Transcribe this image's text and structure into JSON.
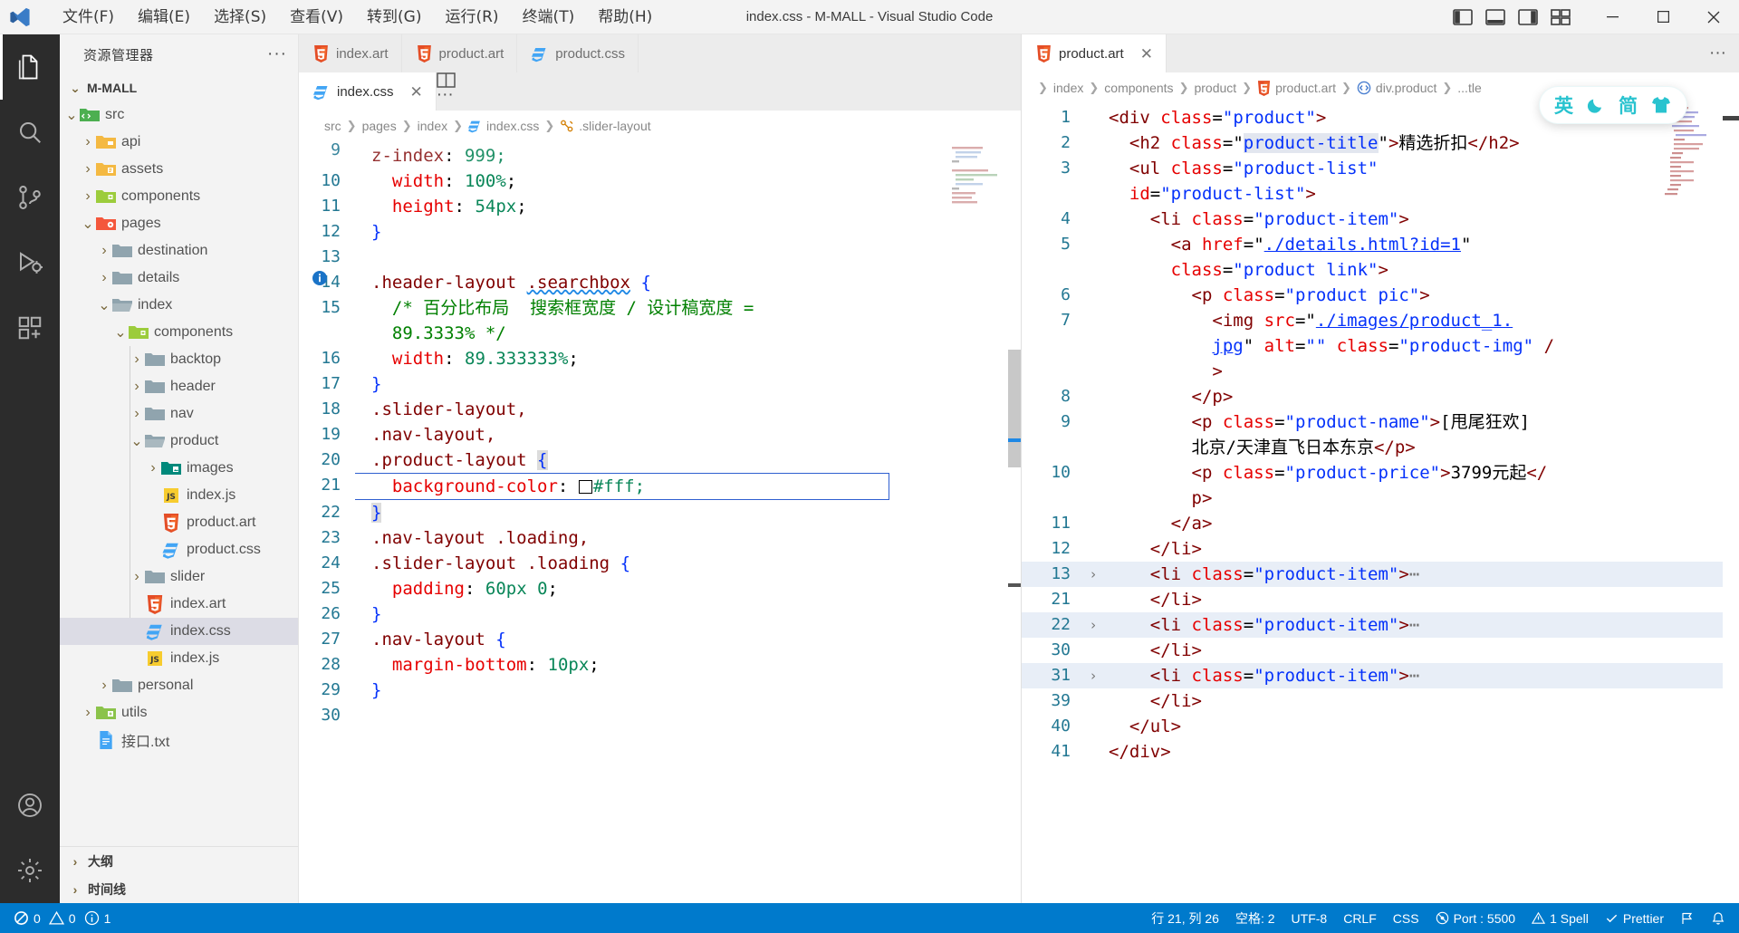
{
  "titlebar": {
    "menus": [
      "文件(F)",
      "编辑(E)",
      "选择(S)",
      "查看(V)",
      "转到(G)",
      "运行(R)",
      "终端(T)",
      "帮助(H)"
    ],
    "window_title": "index.css - M-MALL - Visual Studio Code",
    "minimize": "−",
    "maximize": "▭",
    "close": "✕"
  },
  "activitybar": {
    "items": [
      "explorer-icon",
      "search-icon",
      "source-control-icon",
      "run-debug-icon",
      "extensions-icon",
      "accounts-icon",
      "settings-icon"
    ]
  },
  "sidebar": {
    "title": "资源管理器",
    "more": "···",
    "project": "M-MALL",
    "tree": [
      {
        "label": "src",
        "depth": 1,
        "chev": "v",
        "icon": "folder-src",
        "sel": false
      },
      {
        "label": "api",
        "depth": 2,
        "chev": ">",
        "icon": "folder-api",
        "sel": false
      },
      {
        "label": "assets",
        "depth": 2,
        "chev": ">",
        "icon": "folder-assets",
        "sel": false
      },
      {
        "label": "components",
        "depth": 2,
        "chev": ">",
        "icon": "folder-components",
        "sel": false
      },
      {
        "label": "pages",
        "depth": 2,
        "chev": "v",
        "icon": "folder-pages",
        "sel": false
      },
      {
        "label": "destination",
        "depth": 3,
        "chev": ">",
        "icon": "folder-plain",
        "sel": false
      },
      {
        "label": "details",
        "depth": 3,
        "chev": ">",
        "icon": "folder-plain",
        "sel": false
      },
      {
        "label": "index",
        "depth": 3,
        "chev": "v",
        "icon": "folder-open",
        "sel": false
      },
      {
        "label": "components",
        "depth": 4,
        "chev": "v",
        "icon": "folder-components",
        "sel": false
      },
      {
        "label": "backtop",
        "depth": 5,
        "chev": ">",
        "icon": "folder-plain",
        "sel": false
      },
      {
        "label": "header",
        "depth": 5,
        "chev": ">",
        "icon": "folder-plain",
        "sel": false
      },
      {
        "label": "nav",
        "depth": 5,
        "chev": ">",
        "icon": "folder-plain",
        "sel": false
      },
      {
        "label": "product",
        "depth": 5,
        "chev": "v",
        "icon": "folder-open",
        "sel": false
      },
      {
        "label": "images",
        "depth": 6,
        "chev": ">",
        "icon": "folder-images",
        "sel": false
      },
      {
        "label": "index.js",
        "depth": 6,
        "chev": "",
        "icon": "js",
        "sel": false
      },
      {
        "label": "product.art",
        "depth": 6,
        "chev": "",
        "icon": "html",
        "sel": false
      },
      {
        "label": "product.css",
        "depth": 6,
        "chev": "",
        "icon": "css",
        "sel": false
      },
      {
        "label": "slider",
        "depth": 5,
        "chev": ">",
        "icon": "folder-plain",
        "sel": false
      },
      {
        "label": "index.art",
        "depth": 5,
        "chev": "",
        "icon": "html",
        "sel": false
      },
      {
        "label": "index.css",
        "depth": 5,
        "chev": "",
        "icon": "css",
        "sel": true
      },
      {
        "label": "index.js",
        "depth": 5,
        "chev": "",
        "icon": "js",
        "sel": false
      },
      {
        "label": "personal",
        "depth": 3,
        "chev": ">",
        "icon": "folder-plain",
        "sel": false
      },
      {
        "label": "utils",
        "depth": 2,
        "chev": ">",
        "icon": "folder-utils",
        "sel": false
      },
      {
        "label": "接口.txt",
        "depth": 2,
        "chev": "",
        "icon": "txt",
        "sel": false
      }
    ],
    "sections": [
      "大纲",
      "时间线"
    ]
  },
  "editor_left": {
    "bg_tabs": [
      {
        "label": "index.art",
        "icon": "html"
      },
      {
        "label": "product.art",
        "icon": "html"
      },
      {
        "label": "product.css",
        "icon": "css"
      }
    ],
    "active_tab": {
      "label": "index.css",
      "icon": "css",
      "close": "✕"
    },
    "actions": {
      "split": "split-editor-icon",
      "more": "···"
    },
    "breadcrumb": [
      "src",
      "pages",
      "index",
      "index.css",
      ".slider-layout"
    ],
    "lines": [
      {
        "no": "9",
        "text": "  z-index: 999;",
        "clipped": true
      },
      {
        "no": "10",
        "text": "  width: 100%;"
      },
      {
        "no": "11",
        "text": "  height: 54px;"
      },
      {
        "no": "12",
        "text": "}"
      },
      {
        "no": "13",
        "text": ""
      },
      {
        "no": "14",
        "text": ".header-layout .searchbox {",
        "info": true
      },
      {
        "no": "15",
        "text": "  /* 百分比布局  搜索框宽度 / 设计稿宽度 = 89.3333% */"
      },
      {
        "no": "16",
        "text": "  width: 89.333333%;"
      },
      {
        "no": "17",
        "text": "}"
      },
      {
        "no": "18",
        "text": ".slider-layout,"
      },
      {
        "no": "19",
        "text": ".nav-layout,"
      },
      {
        "no": "20",
        "text": ".product-layout {"
      },
      {
        "no": "21",
        "text": "  background-color: #fff;"
      },
      {
        "no": "22",
        "text": "}"
      },
      {
        "no": "23",
        "text": ".nav-layout .loading,"
      },
      {
        "no": "24",
        "text": ".slider-layout .loading {"
      },
      {
        "no": "25",
        "text": "  padding: 60px 0;"
      },
      {
        "no": "26",
        "text": "}"
      },
      {
        "no": "27",
        "text": ".nav-layout {"
      },
      {
        "no": "28",
        "text": "  margin-bottom: 10px;"
      },
      {
        "no": "29",
        "text": "}"
      },
      {
        "no": "30",
        "text": ""
      }
    ]
  },
  "editor_right": {
    "active_tab": {
      "label": "product.art",
      "icon": "html",
      "close": "✕"
    },
    "more": "···",
    "breadcrumb": [
      "index",
      "components",
      "product",
      "product.art",
      "div.product",
      "...tle"
    ],
    "lines": [
      {
        "no": "1",
        "text": "<div class=\"product\">"
      },
      {
        "no": "2",
        "text": "  <h2 class=\"product-title\">精选折扣</h2>"
      },
      {
        "no": "3",
        "text": "  <ul class=\"product-list\" id=\"product-list\">"
      },
      {
        "no": "4",
        "text": "    <li class=\"product-item\">"
      },
      {
        "no": "5",
        "text": "      <a href=\"./details.html?id=1\" class=\"product link\">"
      },
      {
        "no": "6",
        "text": "        <p class=\"product pic\">"
      },
      {
        "no": "7",
        "text": "          <img src=\"./images/product_1.jpg\" alt=\"\" class=\"product-img\" />"
      },
      {
        "no": "8",
        "text": "        </p>"
      },
      {
        "no": "9",
        "text": "        <p class=\"product-name\">[甩尾狂欢]北京/天津直飞日本东京</p>"
      },
      {
        "no": "10",
        "text": "        <p class=\"product-price\">3799元起</p>"
      },
      {
        "no": "11",
        "text": "      </a>"
      },
      {
        "no": "12",
        "text": "    </li>"
      },
      {
        "no": "13",
        "text": "    <li class=\"product-item\">⋯",
        "folded": true
      },
      {
        "no": "21",
        "text": "    </li>"
      },
      {
        "no": "22",
        "text": "    <li class=\"product-item\">⋯",
        "folded": true
      },
      {
        "no": "30",
        "text": "    </li>"
      },
      {
        "no": "31",
        "text": "    <li class=\"product-item\">⋯",
        "folded": true
      },
      {
        "no": "39",
        "text": "    </li>"
      },
      {
        "no": "40",
        "text": "  </ul>"
      },
      {
        "no": "41",
        "text": "</div>"
      }
    ]
  },
  "ime": {
    "lang": "英",
    "mode_icon": "moon-icon",
    "script": "简",
    "skin_icon": "shirt-icon"
  },
  "statusbar": {
    "left": [
      {
        "icon": "remote-icon",
        "label": ""
      },
      {
        "icon": "error-icon",
        "label": "0"
      },
      {
        "icon": "warning-icon",
        "label": "0"
      },
      {
        "icon": "info-icon",
        "label": "1"
      }
    ],
    "right": [
      {
        "label": "行 21, 列 26"
      },
      {
        "label": "空格: 2"
      },
      {
        "label": "UTF-8"
      },
      {
        "label": "CRLF"
      },
      {
        "label": "CSS"
      },
      {
        "label": "Port : 5500",
        "icon": "broadcast-icon"
      },
      {
        "label": "1 Spell",
        "icon": "alert-icon"
      },
      {
        "label": "Prettier",
        "icon": "check-icon"
      },
      {
        "label": "",
        "icon": "feedback-icon"
      },
      {
        "label": "",
        "icon": "bell-icon"
      }
    ]
  },
  "annotations": {
    "arrow_color": "#e02020",
    "arrows": [
      "arrow-to-product-layout",
      "arrow-to-background-color-line",
      "arrow-to-index-css-file"
    ]
  }
}
